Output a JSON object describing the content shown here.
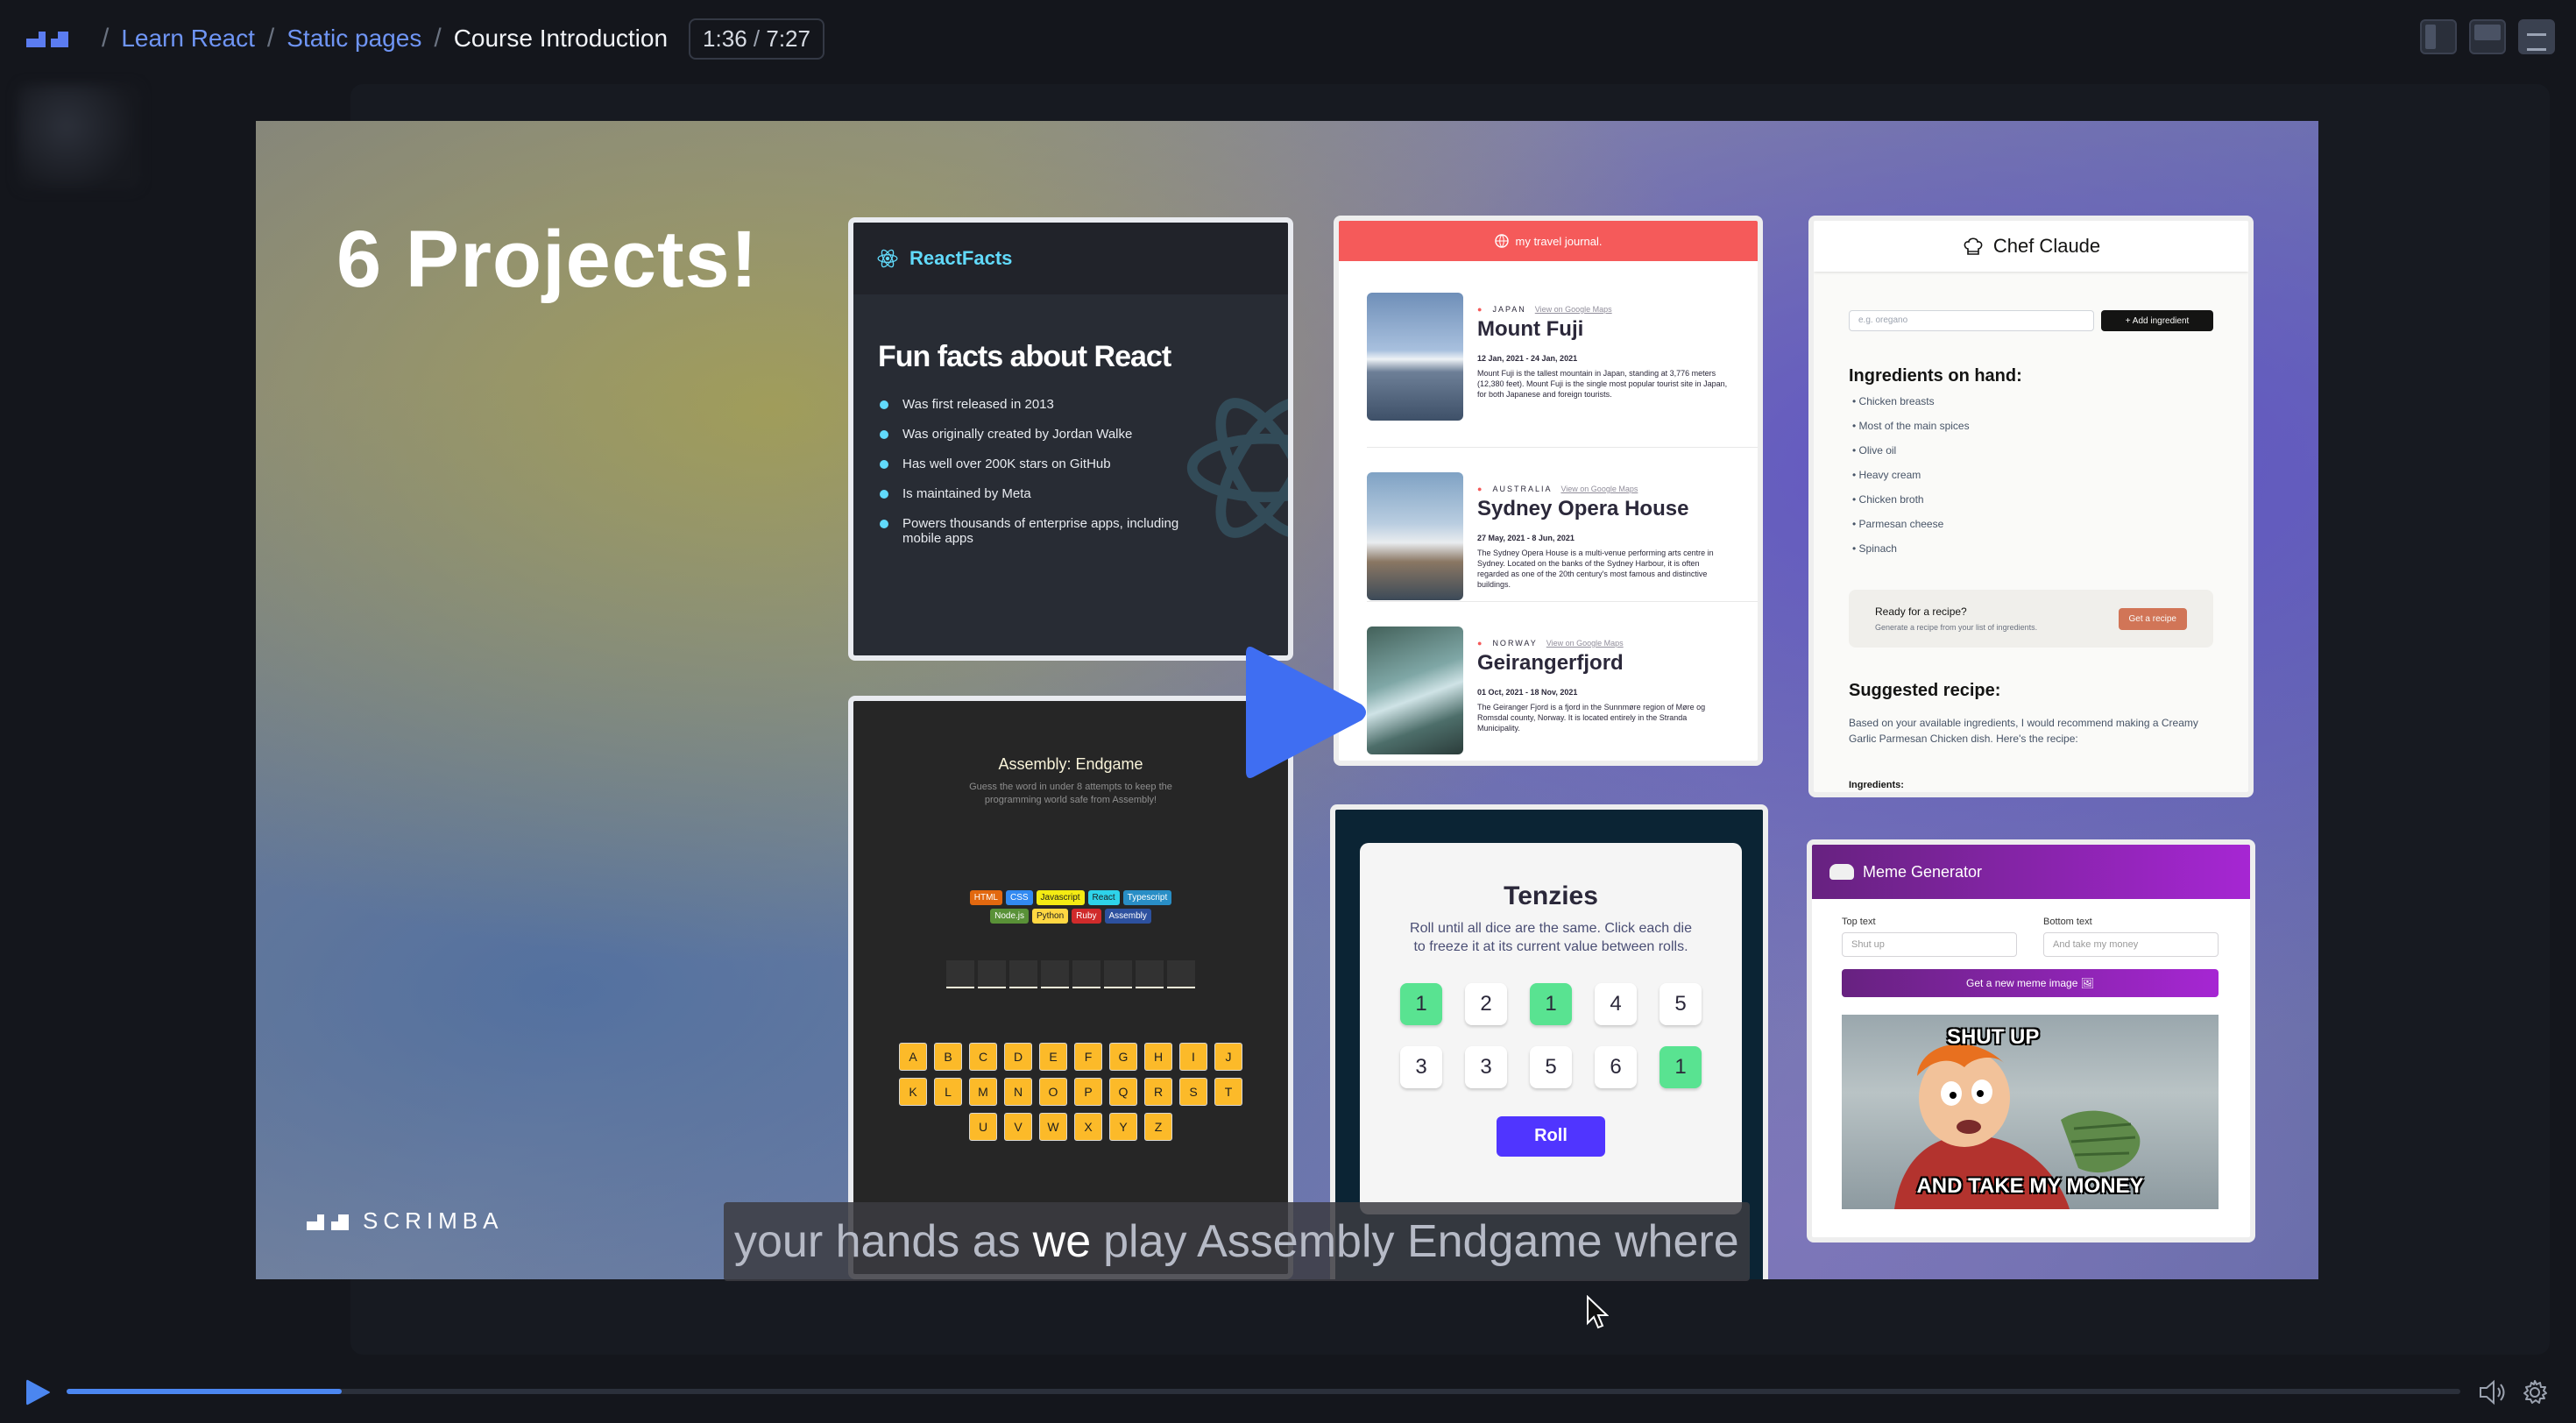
{
  "topbar": {
    "crumbs": [
      "Learn React",
      "Static pages"
    ],
    "current": "Course Introduction",
    "time_current": "1:36",
    "time_sep": "/",
    "time_total": "7:27"
  },
  "player": {
    "progress": 0.115,
    "caption_before": "your hands as",
    "caption_highlight": "we",
    "caption_after": "play Assembly Endgame where"
  },
  "slide": {
    "title": "6 Projects!",
    "brand": "SCRIMBA",
    "reactfacts": {
      "brand": "ReactFacts",
      "heading": "Fun facts about React",
      "facts": [
        "Was first released in 2013",
        "Was originally created by Jordan Walke",
        "Has well over 200K stars on GitHub",
        "Is maintained by Meta",
        "Powers thousands of enterprise apps, including mobile apps"
      ]
    },
    "assembly": {
      "title": "Assembly: Endgame",
      "subtitle": "Guess the word in under 8 attempts to keep the programming world safe from Assembly!",
      "chips": [
        {
          "name": "HTML",
          "color": "#E2680F"
        },
        {
          "name": "CSS",
          "color": "#328AF1"
        },
        {
          "name": "Javascript",
          "color": "#F4EB13"
        },
        {
          "name": "React",
          "color": "#2ED3E9"
        },
        {
          "name": "Typescript",
          "color": "#298EC6"
        },
        {
          "name": "Node.js",
          "color": "#599137"
        },
        {
          "name": "Python",
          "color": "#FFD742"
        },
        {
          "name": "Ruby",
          "color": "#D02B2B"
        },
        {
          "name": "Assembly",
          "color": "#2D519F"
        }
      ],
      "keys": [
        "A",
        "B",
        "C",
        "D",
        "E",
        "F",
        "G",
        "H",
        "I",
        "J",
        "K",
        "L",
        "M",
        "N",
        "O",
        "P",
        "Q",
        "R",
        "S",
        "T",
        "U",
        "V",
        "W",
        "X",
        "Y",
        "Z"
      ]
    },
    "travel": {
      "header": "my travel journal.",
      "maps_label": "View on Google Maps",
      "entries": [
        {
          "country": "JAPAN",
          "place": "Mount Fuji",
          "dates": "12 Jan, 2021 - 24 Jan, 2021",
          "desc": "Mount Fuji is the tallest mountain in Japan, standing at 3,776 meters (12,380 feet). Mount Fuji is the single most popular tourist site in Japan, for both Japanese and foreign tourists."
        },
        {
          "country": "AUSTRALIA",
          "place": "Sydney Opera House",
          "dates": "27 May, 2021 - 8 Jun, 2021",
          "desc": "The Sydney Opera House is a multi-venue performing arts centre in Sydney. Located on the banks of the Sydney Harbour, it is often regarded as one of the 20th century's most famous and distinctive buildings."
        },
        {
          "country": "NORWAY",
          "place": "Geirangerfjord",
          "dates": "01 Oct, 2021 - 18 Nov, 2021",
          "desc": "The Geiranger Fjord is a fjord in the Sunnmøre region of Møre og Romsdal county, Norway. It is located entirely in the Stranda Municipality."
        }
      ]
    },
    "chef": {
      "title": "Chef Claude",
      "input_placeholder": "e.g. oregano",
      "add_label": "+ Add ingredient",
      "on_hand_heading": "Ingredients on hand:",
      "ingredients": [
        "Chicken breasts",
        "Most of the main spices",
        "Olive oil",
        "Heavy cream",
        "Chicken broth",
        "Parmesan cheese",
        "Spinach"
      ],
      "ready_title": "Ready for a recipe?",
      "ready_sub": "Generate a recipe from your list of ingredients.",
      "get_label": "Get a recipe",
      "suggested_heading": "Suggested recipe:",
      "suggested_text": "Based on your available ingredients, I would recommend making a Creamy Garlic Parmesan Chicken dish. Here's the recipe:",
      "ingredients_label": "Ingredients:"
    },
    "tenzies": {
      "title": "Tenzies",
      "desc": "Roll until all dice are the same. Click each die to freeze it at its current value between rolls.",
      "dice": [
        {
          "value": "1",
          "held": true
        },
        {
          "value": "2",
          "held": false
        },
        {
          "value": "1",
          "held": true
        },
        {
          "value": "4",
          "held": false
        },
        {
          "value": "5",
          "held": false
        },
        {
          "value": "3",
          "held": false
        },
        {
          "value": "3",
          "held": false
        },
        {
          "value": "5",
          "held": false
        },
        {
          "value": "6",
          "held": false
        },
        {
          "value": "1",
          "held": true
        }
      ],
      "roll_label": "Roll"
    },
    "meme": {
      "title": "Meme Generator",
      "top_label": "Top text",
      "bottom_label": "Bottom text",
      "top_value": "Shut up",
      "bottom_value": "And take my money",
      "button_label": "Get a new meme image 🖼",
      "top_text": "SHUT UP",
      "bottom_text": "AND TAKE MY MONEY"
    }
  }
}
